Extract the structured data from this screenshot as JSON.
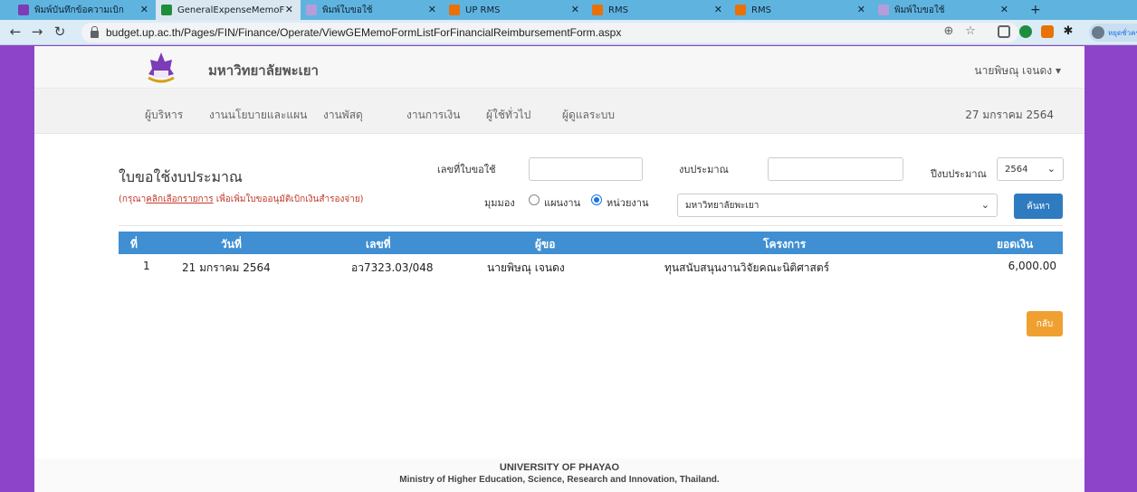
{
  "browser": {
    "tabs": [
      {
        "title": "พิมพ์บันทึกข้อความเบิก",
        "color": "#7d3cb5"
      },
      {
        "title": "GeneralExpenseMemoF",
        "color": "#1e8e3e"
      },
      {
        "title": "พิมพ์ใบขอใช้",
        "color": "#b39ddb"
      },
      {
        "title": "UP RMS",
        "color": "#e8710a"
      },
      {
        "title": "RMS",
        "color": "#e8710a"
      },
      {
        "title": "RMS",
        "color": "#e8710a"
      },
      {
        "title": "พิมพ์ใบขอใช้",
        "color": "#b39ddb"
      }
    ],
    "url": "budget.up.ac.th/Pages/FIN/Finance/Operate/ViewGEMemoFormListForFinancialReimbursementForm.aspx",
    "profile_label": "หยุดชั่วคราว"
  },
  "header": {
    "site_title": "มหาวิทยาลัยพะเยา",
    "user_name": "นายพิษณุ เจนดง ▾"
  },
  "nav": {
    "items": [
      "ผู้บริหาร",
      "งานนโยบายและแผน",
      "งานพัสดุ",
      "งานการเงิน",
      "ผู้ใช้ทั่วไป",
      "ผู้ดูแลระบบ"
    ],
    "date": "27 มกราคม 2564"
  },
  "form": {
    "title": "ใบขอใช้งบประมาณ",
    "hint_prefix": "(กรุณา",
    "hint_link": "คลิกเลือกรายการ",
    "hint_suffix": " เพื่อเพิ่มใบขออนุมัติเบิกเงินสำรองจ่าย)",
    "request_no_label": "เลขที่ใบขอใช้",
    "request_no_value": "",
    "budget_label": "งบประมาณ",
    "budget_value": "",
    "fiscal_year_label": "ปีงบประมาณ",
    "fiscal_year_value": "2564",
    "view_label": "มุมมอง",
    "view_option_plan": "แผนงาน",
    "view_option_unit": "หน่วยงาน",
    "view_selected": "หน่วยงาน",
    "unit_value": "มหาวิทยาลัยพะเยา",
    "search_button": "ค้นหา",
    "back_button": "กลับ"
  },
  "table": {
    "columns": [
      "ที่",
      "วันที่",
      "เลขที่",
      "ผู้ขอ",
      "โครงการ",
      "ยอดเงิน"
    ],
    "rows": [
      {
        "no": "1",
        "date": "21 มกราคม 2564",
        "doc_no": "อว7323.03/048",
        "requester": "นายพิษณุ เจนดง",
        "project": "ทุนสนับสนุนงานวิจัยคณะนิติศาสตร์",
        "amount": "6,000.00"
      }
    ]
  },
  "footer": {
    "line1": "UNIVERSITY OF PHAYAO",
    "line2": "Ministry of Higher Education, Science, Research and Innovation, Thailand."
  }
}
